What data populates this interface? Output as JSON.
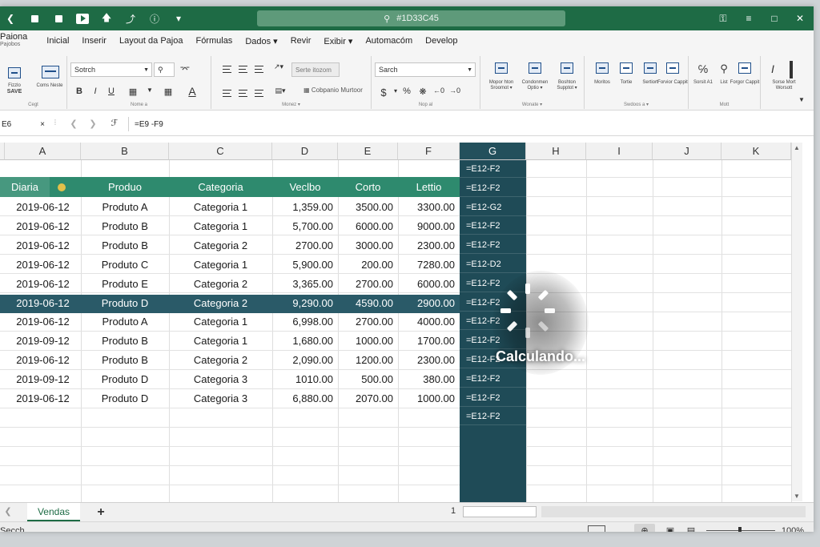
{
  "titlebar": {
    "search_text": "#1D33C45"
  },
  "menu": {
    "first_label": "Paiona",
    "first_sub": "Pajobos",
    "items": [
      "Inicial",
      "Inserir",
      "Layout da Pajoa",
      "Fórmulas",
      "Dados ▾",
      "Revir",
      "Exibir ▾",
      "Automacóm",
      "Develop"
    ]
  },
  "ribbon": {
    "paste_label": "Fizzlo",
    "paste_sub": "SAVE",
    "group1_btn2": "Coms Neste",
    "group1_label": "Cegt",
    "font_name": "Sotrch",
    "group2_label": "Nome a",
    "align_style_btn": "Serte itozom",
    "merge_label": "Cobpanio Murtoor",
    "group3_label": "Monez ▾",
    "number_format": "Sarch",
    "currency_symbol": "$",
    "percent_symbol": "%",
    "group4_label": "Nop al",
    "styles_items": [
      "Mopor hton Sroomot ▾",
      "Condonmen Optio ▾",
      "Boshton Supptot ▾"
    ],
    "group5_label": "Wonate ▾",
    "cells_items": [
      "Moritos",
      "Tortie",
      "Sertiort",
      "Forvior Cappit"
    ],
    "group6_label": "Swdoos a ▾",
    "edit_items": [
      "Sorsit A1",
      "List",
      "Forgor Cappit"
    ],
    "group7_label": "Mott",
    "last_items": "Sorse Mort Worsott"
  },
  "formula_bar": {
    "cell_ref": "E6",
    "cancel_icon_label": "×",
    "fx_label": "fx",
    "formula": "=E9 -F9"
  },
  "columns": [
    "A",
    "B",
    "C",
    "D",
    "E",
    "F",
    "G",
    "H",
    "I",
    "J",
    "K"
  ],
  "table": {
    "headers": [
      "Diaria",
      "Produo",
      "Categoria",
      "Veclbo",
      "Corto",
      "Lettio"
    ],
    "rows": [
      [
        "2019-06-12",
        "Produto A",
        "Categoria 1",
        "1,359.00",
        "3500.00",
        "3300.00"
      ],
      [
        "2019-06-12",
        "Produto B",
        "Categoria 1",
        "5,700.00",
        "6000.00",
        "9000.00"
      ],
      [
        "2019-06-12",
        "Produto B",
        "Categoria 2",
        "2700.00",
        "3000.00",
        "2300.00"
      ],
      [
        "2019-06-12",
        "Produto C",
        "Categoria 1",
        "5,900.00",
        "200.00",
        "7280.00"
      ],
      [
        "2019-06-12",
        "Produto E",
        "Categoria 2",
        "3,365.00",
        "2700.00",
        "6000.00"
      ],
      [
        "2019-06-12",
        "Produto D",
        "Categoria 2",
        "9,290.00",
        "4590.00",
        "2900.00"
      ],
      [
        "2019-06-12",
        "Produto A",
        "Categoria 1",
        "6,998.00",
        "2700.00",
        "4000.00"
      ],
      [
        "2019-09-12",
        "Produto B",
        "Categoria 1",
        "1,680.00",
        "1000.00",
        "1700.00"
      ],
      [
        "2019-06-12",
        "Produto B",
        "Categoria 2",
        "2,090.00",
        "1200.00",
        "2300.00"
      ],
      [
        "2019-09-12",
        "Produto D",
        "Categoria 3",
        "1010.00",
        "500.00",
        "380.00"
      ],
      [
        "2019-06-12",
        "Produto D",
        "Categoria 3",
        "6,880.00",
        "2070.00",
        "1000.00"
      ]
    ],
    "selected_row_index": 5
  },
  "column_g": [
    "=E12-F2",
    "=E12-F2",
    "=E12-G2",
    "=E12-F2",
    "=E12-F2",
    "=E12-D2",
    "=E12-F2",
    "=E12-F2",
    "=E12-F2",
    "=E12-F2",
    "=E12-F2",
    "=E12-F2",
    "=E12-F2",
    "=E12-F2"
  ],
  "spinner": {
    "label": "Calculando..."
  },
  "sheet_tabs": {
    "active": "Vendas",
    "add_label": "+",
    "page_indicator": "1"
  },
  "status": {
    "left_text": "Secch",
    "zoom": "100%"
  },
  "colors": {
    "titlebar": "#1e6b45",
    "header_row": "#2e8a6e",
    "selected_row": "#2a5a68",
    "column_g": "#1f4b57"
  }
}
